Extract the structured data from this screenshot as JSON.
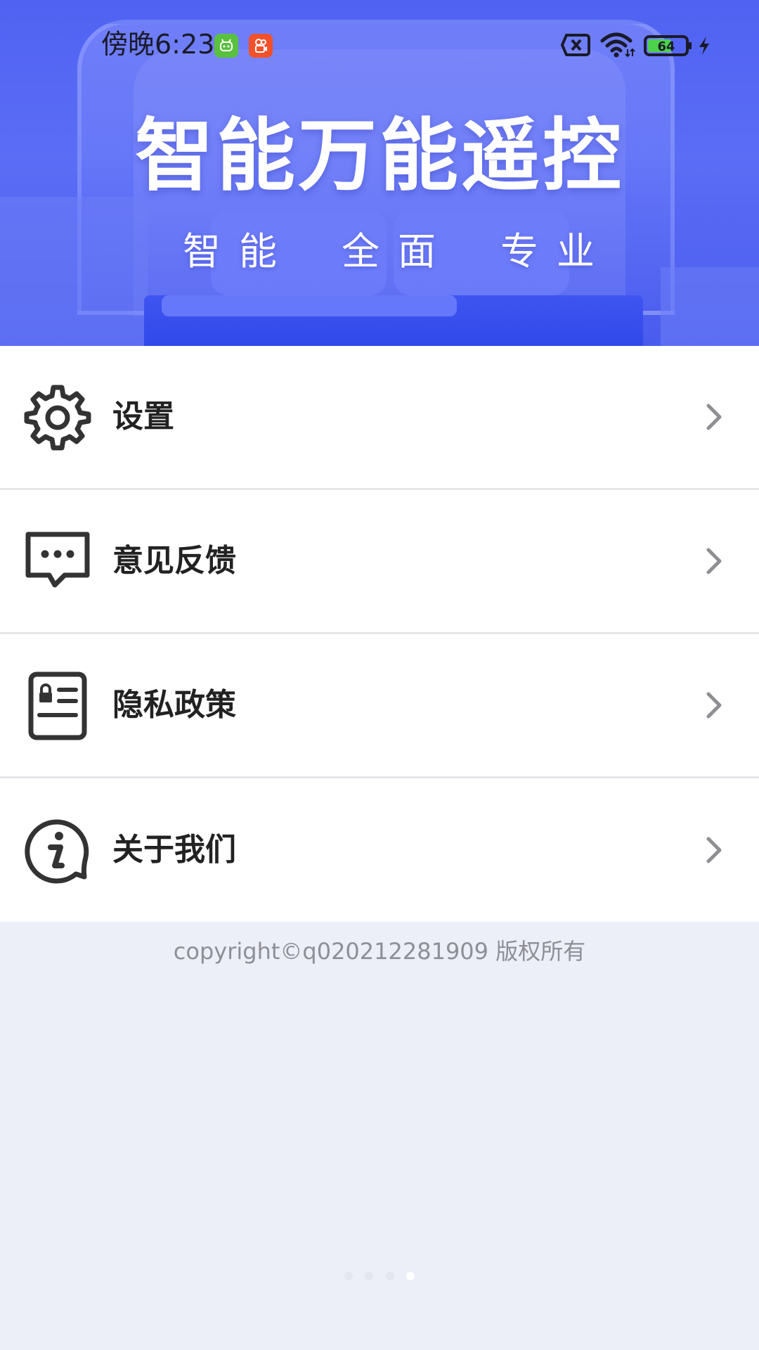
{
  "status_bar": {
    "time": "傍晚6:23",
    "battery_level": "64",
    "notification_icons": [
      "app-green-icon",
      "app-orange-icon"
    ],
    "system_icons": [
      "no-sim-icon",
      "wifi-icon",
      "battery-icon",
      "charging-icon"
    ]
  },
  "banner": {
    "title": "智能万能遥控",
    "subtitle_1": "智能",
    "subtitle_2": "全面",
    "subtitle_3": "专业",
    "background_color": "#4F62F2"
  },
  "menu": {
    "items": [
      {
        "label": "设置",
        "icon": "gear-icon"
      },
      {
        "label": "意见反馈",
        "icon": "message-icon"
      },
      {
        "label": "隐私政策",
        "icon": "privacy-document-icon"
      },
      {
        "label": "关于我们",
        "icon": "info-icon"
      }
    ]
  },
  "footer": {
    "copyright": "copyright©q020212281909 版权所有"
  },
  "pager": {
    "total": 4,
    "active_index": 3
  },
  "colors": {
    "page_background": "#ECEEF8",
    "menu_text": "#222222",
    "chevron": "#8E8E93",
    "copyright_text": "#8E8F96"
  }
}
